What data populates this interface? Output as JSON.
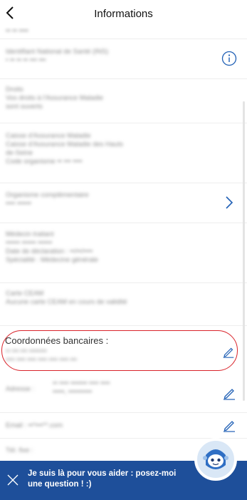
{
  "header": {
    "title": "Informations"
  },
  "rows": [
    {
      "lines": [
        "•• •• ••••"
      ]
    },
    {
      "lines": [
        "Identifiant National de Santé (INS)",
        "• •• •• •• ••• •••"
      ]
    },
    {
      "lines": [
        "Droits",
        "Vos droits à l'Assurance Maladie",
        "sont ouverts"
      ]
    },
    {
      "lines": [
        "Caisse d'Assurance Maladie",
        "Caisse d'Assurance Maladie des Hauts",
        "de-Seine",
        "Code organisme •• ••• ••••"
      ]
    },
    {
      "lines": [
        "Organisme complémentaire",
        "•••• ••••••"
      ]
    },
    {
      "lines": [
        "Médecin traitant",
        "•••••• •••••• ••••••",
        "Date de déclaration : ••/••/••••",
        "Spécialité : Médecine générale"
      ]
    },
    {
      "lines": [
        "Carte CEAM",
        "Aucune carte CEAM en cours de validité"
      ]
    }
  ],
  "bank": {
    "title": "Coordonnées bancaires :",
    "line1": "•• ••• ••• ••••••••",
    "line2": "•••• •••• •••• •••• •••• •••• •••"
  },
  "address": {
    "label": "Adresse :",
    "line1": "•• •••• ••••••• •••• ••••",
    "line2": "•••••, ••••••••••"
  },
  "email": {
    "label": "Email :",
    "value": "••*•••**.com"
  },
  "phone": {
    "label": "Tél. fixe :"
  },
  "assistant": {
    "message": "Je suis là pour vous aider : posez-moi une question ! :)"
  },
  "colors": {
    "banner": "#1e4f9a",
    "accent": "#1f5fb5",
    "highlight": "#d9232a"
  }
}
